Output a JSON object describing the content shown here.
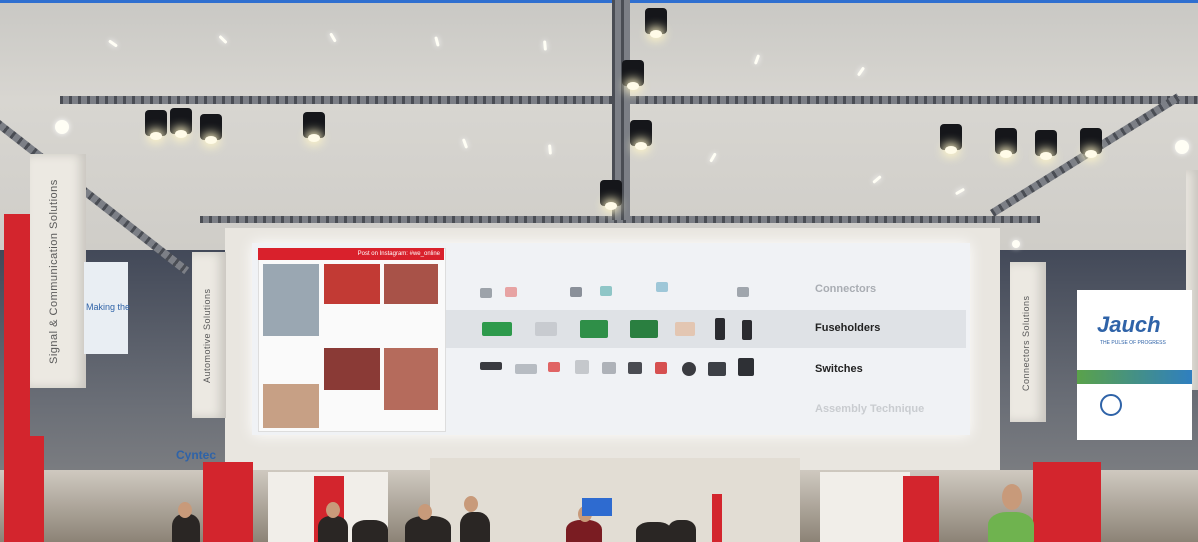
{
  "screen": {
    "social_header": "Post on Instagram: #we_online",
    "rows": [
      "Connectors",
      "Fuseholders",
      "Switches",
      "Assembly Technique"
    ]
  },
  "banners": {
    "left_1": "Signal & Communication Solutions",
    "left_2": "Automotive Solutions",
    "right_1": "Connectors Solutions",
    "partial": "Making the"
  },
  "jauch": {
    "logo": "Jauch",
    "tagline": "THE PULSE OF PROGRESS"
  },
  "cyntec": {
    "logo": "Cyntec"
  },
  "colors": {
    "brand_red": "#d3252d",
    "jauch_blue": "#2f63a8"
  }
}
